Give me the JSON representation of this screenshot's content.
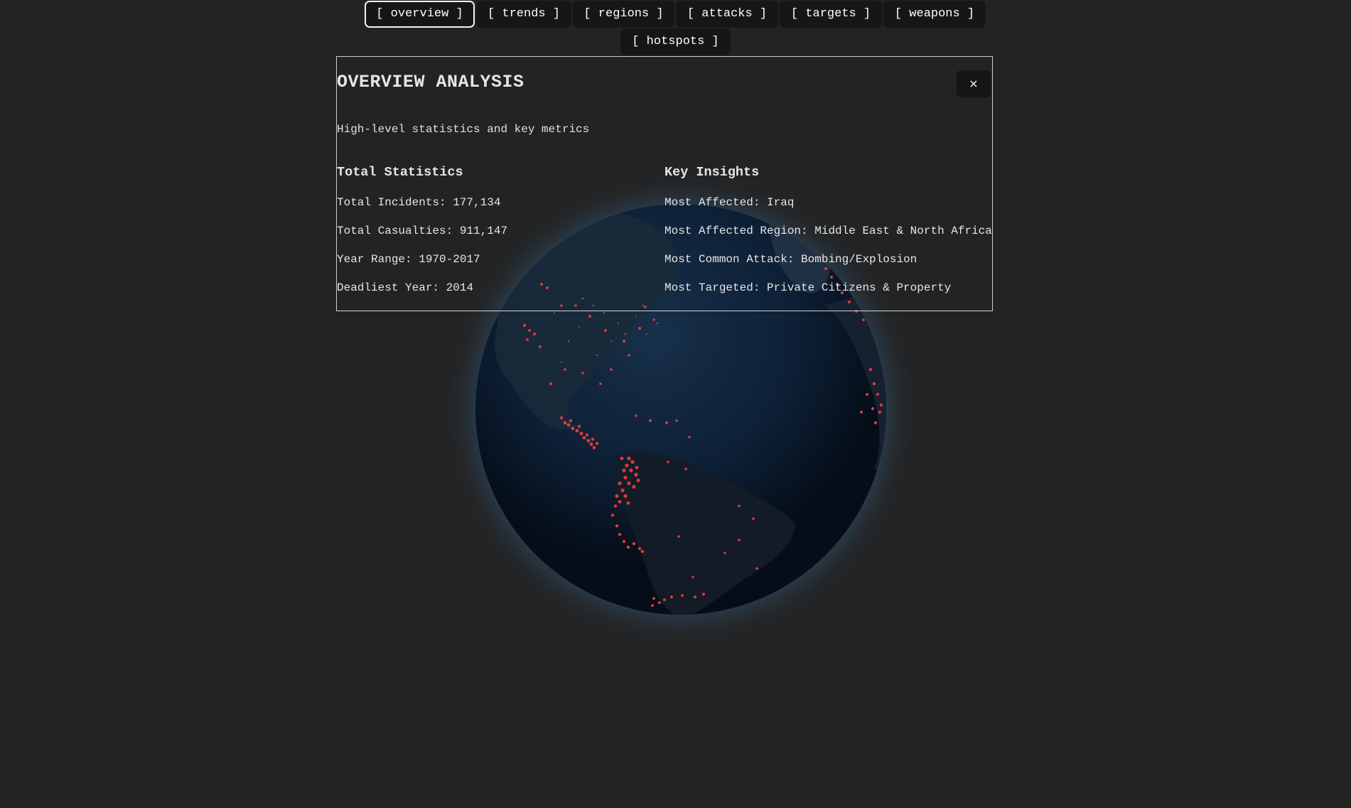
{
  "tabs": [
    {
      "label": "[ overview ]",
      "active": true
    },
    {
      "label": "[ trends ]",
      "active": false
    },
    {
      "label": "[ regions ]",
      "active": false
    },
    {
      "label": "[ attacks ]",
      "active": false
    },
    {
      "label": "[ targets ]",
      "active": false
    },
    {
      "label": "[ weapons ]",
      "active": false
    },
    {
      "label": "[ hotspots ]",
      "active": false
    }
  ],
  "panel": {
    "title": "OVERVIEW ANALYSIS",
    "close_label": "×",
    "subtitle": "High-level statistics and key metrics",
    "total_statistics": {
      "heading": "Total Statistics",
      "items": [
        "Total Incidents: 177,134",
        "Total Casualties: 911,147",
        "Year Range: 1970-2017",
        "Deadliest Year: 2014"
      ]
    },
    "key_insights": {
      "heading": "Key Insights",
      "items": [
        "Most Affected: Iraq",
        "Most Affected Region: Middle East & North Africa",
        "Most Common Attack: Bombing/Explosion",
        "Most Targeted: Private Citizens & Property"
      ]
    }
  },
  "colors": {
    "background": "#232323",
    "tab_background": "#161616",
    "incident_dot": "#e0393c",
    "globe_ocean": "#0a1a2e",
    "globe_glow": "#3b6a8f"
  },
  "icons": {
    "close": "close-icon"
  }
}
